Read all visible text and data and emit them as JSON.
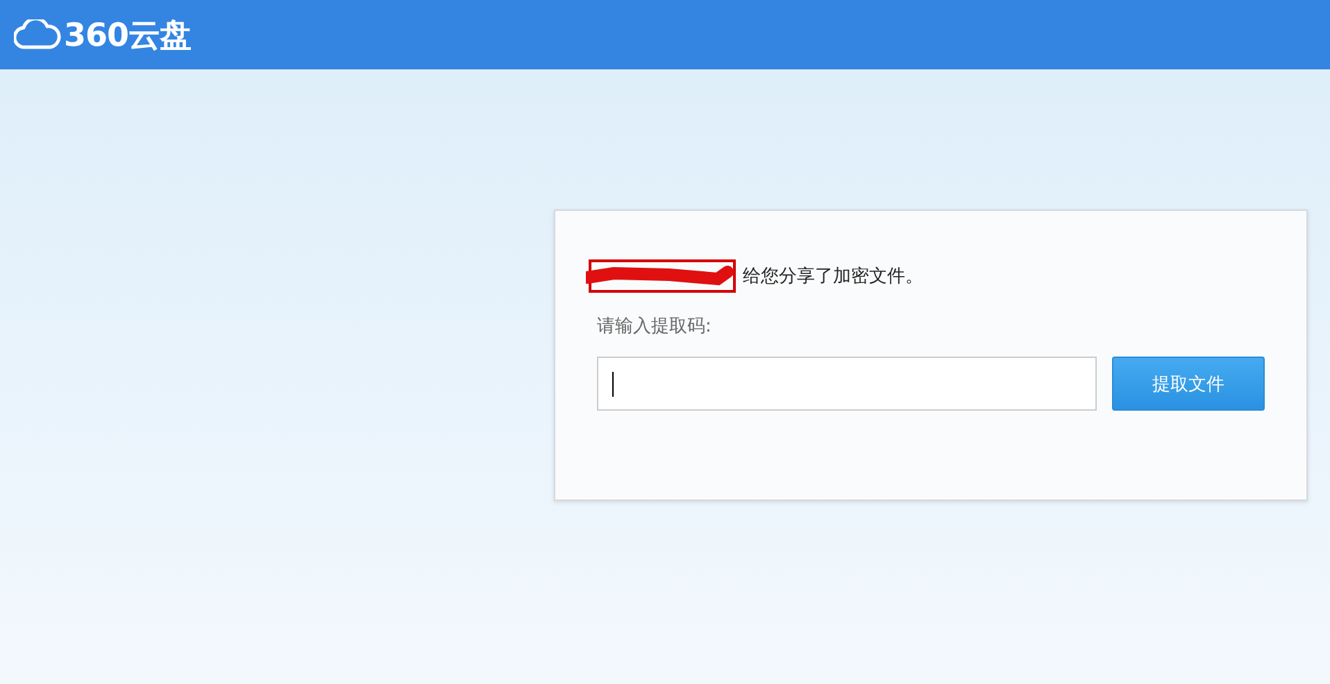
{
  "header": {
    "logo_text": "360云盘"
  },
  "share_card": {
    "message": "给您分享了加密文件。",
    "sender_redacted": true,
    "prompt": "请输入提取码:",
    "code_field": {
      "focused": true
    },
    "submit_button": "提取文件"
  }
}
